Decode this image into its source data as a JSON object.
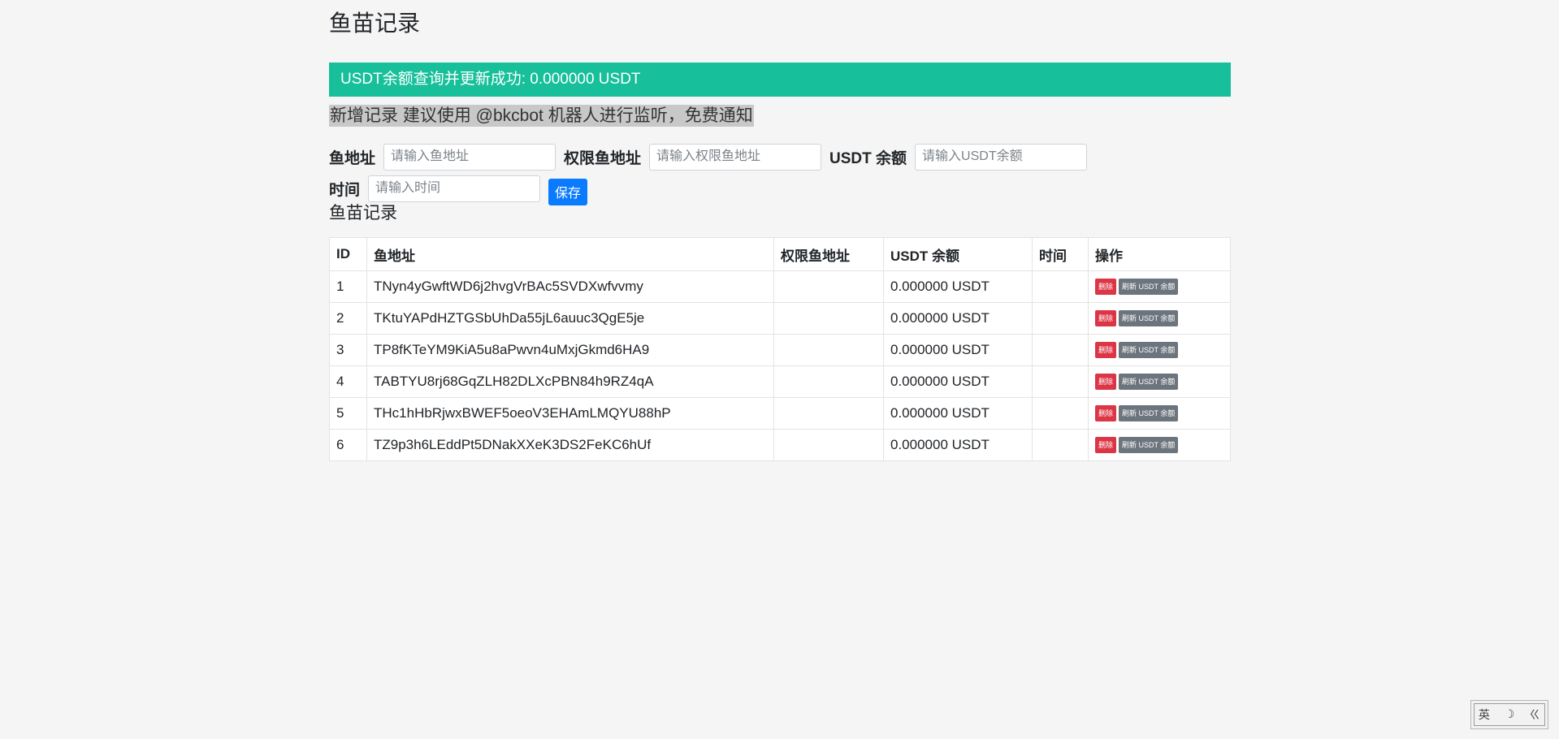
{
  "page": {
    "title": "鱼苗记录",
    "alert_message": "USDT余额查询并更新成功: 0.000000 USDT",
    "notice": "新增记录 建议使用 @bkcbot 机器人进行监听，免费通知"
  },
  "form": {
    "fish_address_label": "鱼地址",
    "fish_address_placeholder": "请输入鱼地址",
    "perm_address_label": "权限鱼地址",
    "perm_address_placeholder": "请输入权限鱼地址",
    "usdt_label": "USDT 余额",
    "usdt_placeholder": "请输入USDT余额",
    "time_label": "时间",
    "time_placeholder": "请输入时间",
    "save_label": "保存"
  },
  "table": {
    "title": "鱼苗记录",
    "headers": {
      "id": "ID",
      "address": "鱼地址",
      "perm_address": "权限鱼地址",
      "usdt": "USDT 余额",
      "time": "时间",
      "actions": "操作"
    },
    "delete_label": "删除",
    "refresh_label": "刷新 USDT 余额",
    "rows": [
      {
        "id": "1",
        "address": "TNyn4yGwftWD6j2hvgVrBAc5SVDXwfvvmy",
        "perm_address": "",
        "usdt": "0.000000 USDT",
        "time": ""
      },
      {
        "id": "2",
        "address": "TKtuYAPdHZTGSbUhDa55jL6auuc3QgE5je",
        "perm_address": "",
        "usdt": "0.000000 USDT",
        "time": ""
      },
      {
        "id": "3",
        "address": "TP8fKTeYM9KiA5u8aPwvn4uMxjGkmd6HA9",
        "perm_address": "",
        "usdt": "0.000000 USDT",
        "time": ""
      },
      {
        "id": "4",
        "address": "TABTYU8rj68GqZLH82DLXcPBN84h9RZ4qA",
        "perm_address": "",
        "usdt": "0.000000 USDT",
        "time": ""
      },
      {
        "id": "5",
        "address": "THc1hHbRjwxBWEF5oeoV3EHAmLMQYU88hP",
        "perm_address": "",
        "usdt": "0.000000 USDT",
        "time": ""
      },
      {
        "id": "6",
        "address": "TZ9p3h6LEddPt5DNakXXeK3DS2FeKC6hUf",
        "perm_address": "",
        "usdt": "0.000000 USDT",
        "time": ""
      }
    ]
  },
  "ime": {
    "lang": "英",
    "moon": "☽",
    "mode": "ㄍ"
  },
  "colors": {
    "alert_bg": "#17bf9b",
    "save_button": "#0a7bff",
    "delete_button": "#dc3545",
    "refresh_button": "#6c757d"
  }
}
